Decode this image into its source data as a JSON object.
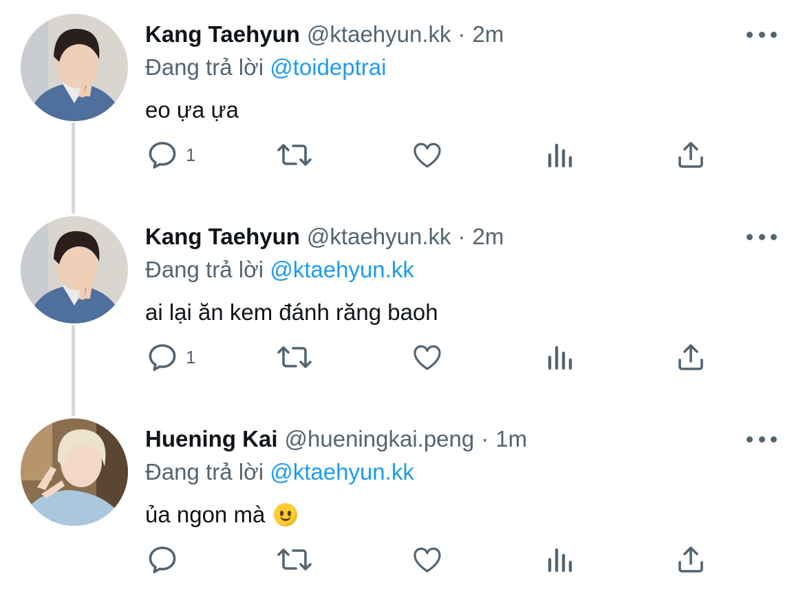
{
  "colors": {
    "mention": "#1d9bf0",
    "secondary_text": "#536471",
    "thread_line": "#cfd9de"
  },
  "tweets": [
    {
      "name": "Kang Taehyun",
      "handle": "@ktaehyun.kk",
      "separator": "·",
      "time": "2m",
      "replying_prefix": "Đang trả lời",
      "replying_to": "@toideptrai",
      "text": "eo ựa ựa",
      "emoji": "",
      "reply_count": "1",
      "icons": {
        "more": "more-icon",
        "reply": "reply-icon",
        "retweet": "retweet-icon",
        "like": "like-icon",
        "views": "views-icon",
        "share": "share-icon"
      }
    },
    {
      "name": "Kang Taehyun",
      "handle": "@ktaehyun.kk",
      "separator": "·",
      "time": "2m",
      "replying_prefix": "Đang trả lời",
      "replying_to": "@ktaehyun.kk",
      "text": "ai lại ăn kem đánh răng baoh",
      "emoji": "",
      "reply_count": "1",
      "icons": {
        "more": "more-icon",
        "reply": "reply-icon",
        "retweet": "retweet-icon",
        "like": "like-icon",
        "views": "views-icon",
        "share": "share-icon"
      }
    },
    {
      "name": "Huening Kai",
      "handle": "@hueningkai.peng",
      "separator": "·",
      "time": "1m",
      "replying_prefix": "Đang trả lời",
      "replying_to": "@ktaehyun.kk",
      "text": "ủa ngon mà",
      "emoji": "slightly-smiling-face",
      "reply_count": "",
      "icons": {
        "more": "more-icon",
        "reply": "reply-icon",
        "retweet": "retweet-icon",
        "like": "like-icon",
        "views": "views-icon",
        "share": "share-icon"
      }
    }
  ]
}
